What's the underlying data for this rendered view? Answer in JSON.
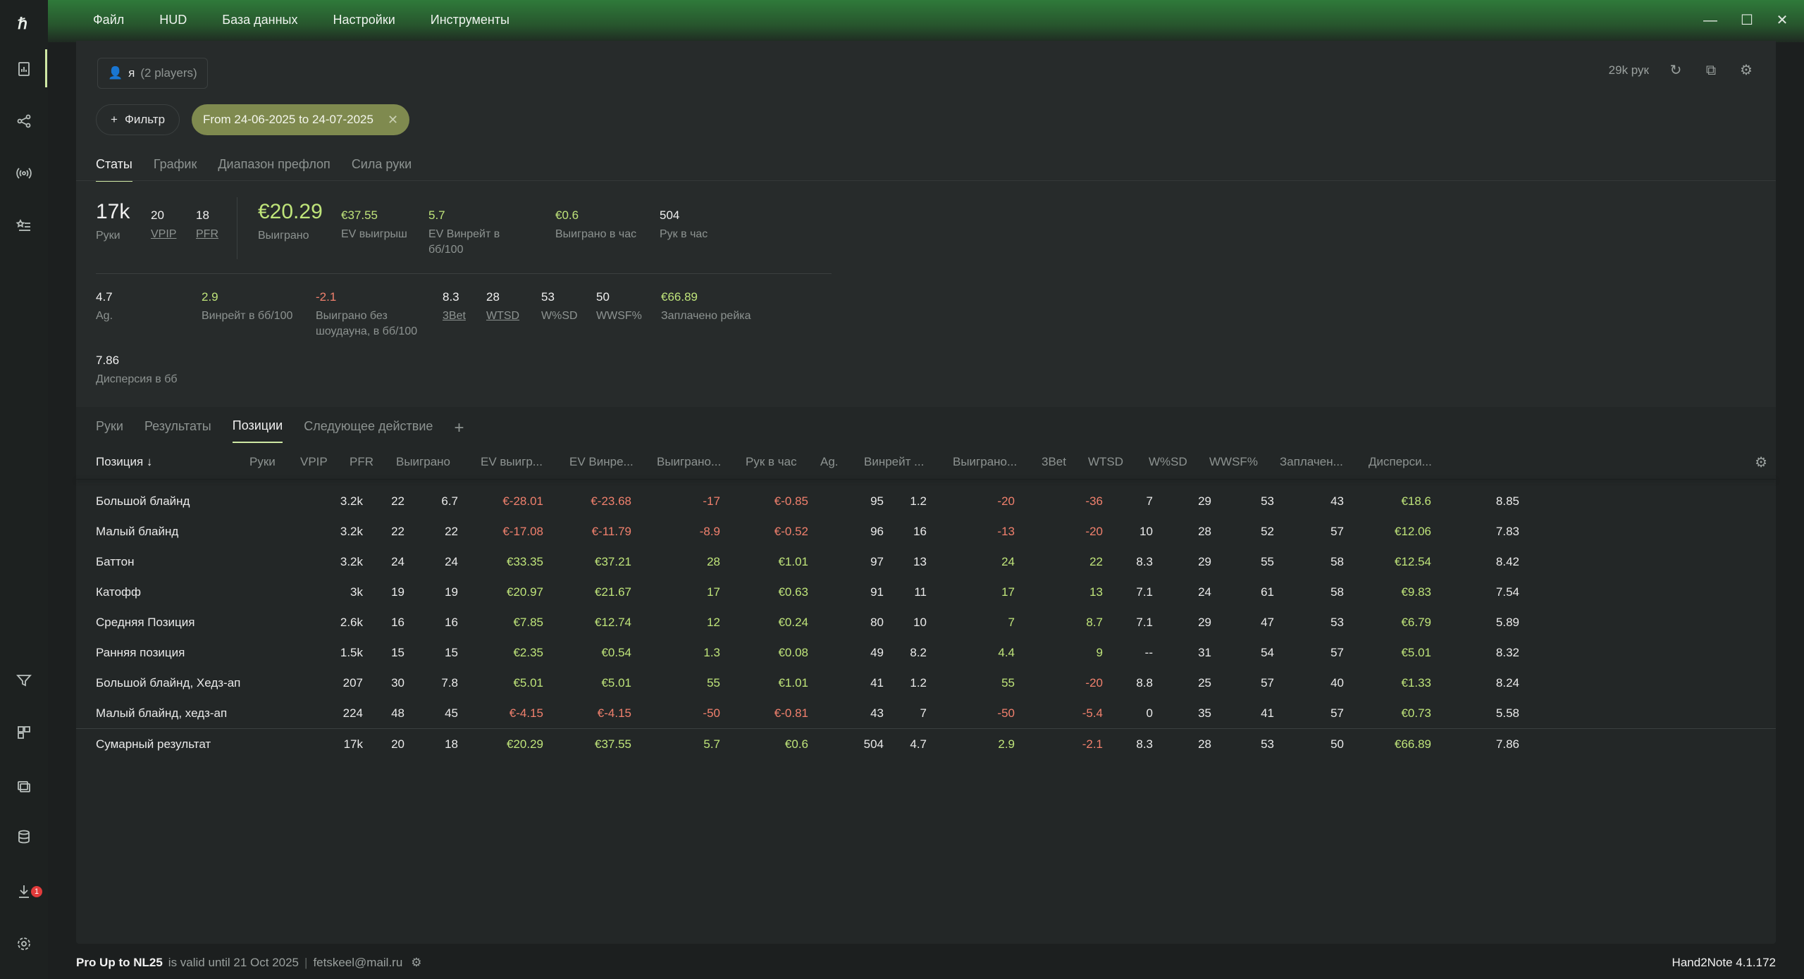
{
  "menu": [
    "Файл",
    "HUD",
    "База данных",
    "Настройки",
    "Инструменты"
  ],
  "window_controls": {
    "minimize": "—",
    "maximize": "☐",
    "close": "✕"
  },
  "sidebar_icons": [
    "reports-icon",
    "share-nodes-icon",
    "broadcast-icon",
    "starred-list-icon",
    "filter-icon",
    "layout-icon",
    "layers-icon",
    "database-icon",
    "download-icon",
    "settings-icon"
  ],
  "sidebar_badge": "1",
  "player": {
    "name": "я",
    "count": "(2 players)"
  },
  "hands_total": "29k рук",
  "filter_label": "Фильтр",
  "date_range": "From 24-06-2025 to 24-07-2025",
  "top_tabs": [
    "Статы",
    "График",
    "Диапазон префлоп",
    "Сила руки"
  ],
  "stats": {
    "hands": {
      "v": "17k",
      "l": "Руки"
    },
    "vpip": {
      "v": "20",
      "l": "VPIP"
    },
    "pfr": {
      "v": "18",
      "l": "PFR"
    },
    "won": {
      "v": "€20.29",
      "l": "Выиграно"
    },
    "ev_won": {
      "v": "€37.55",
      "l": "EV выигрыш"
    },
    "ev_winrate": {
      "v": "5.7",
      "l": "EV Винрейт в бб/100"
    },
    "won_hour": {
      "v": "€0.6",
      "l": "Выиграно в час"
    },
    "hands_hour": {
      "v": "504",
      "l": "Рук в час"
    },
    "ag": {
      "v": "4.7",
      "l": "Ag."
    },
    "winrate": {
      "v": "2.9",
      "l": "Винрейт в бб/100"
    },
    "won_nosd": {
      "v": "-2.1",
      "l": "Выиграно без шоудауна, в бб/100"
    },
    "threebet": {
      "v": "8.3",
      "l": "3Bet"
    },
    "wtsd": {
      "v": "28",
      "l": "WTSD"
    },
    "wsd": {
      "v": "53",
      "l": "W%SD"
    },
    "wwsf": {
      "v": "50",
      "l": "WWSF%"
    },
    "rake": {
      "v": "€66.89",
      "l": "Заплачено рейка"
    },
    "variance": {
      "v": "7.86",
      "l": "Дисперсия в бб"
    }
  },
  "bottom_tabs": [
    "Руки",
    "Результаты",
    "Позиции",
    "Следующее действие"
  ],
  "table": {
    "headers": [
      "Позиция ↓",
      "Руки",
      "VPIP",
      "PFR",
      "Выиграно",
      "EV выигр...",
      "EV Винре...",
      "Выиграно...",
      "Рук в час",
      "Ag.",
      "Винрейт ...",
      "Выиграно...",
      "3Bet",
      "WTSD",
      "W%SD",
      "WWSF%",
      "Заплачен...",
      "Дисперси..."
    ],
    "rows": [
      [
        "Большой блайнд",
        "3.2k",
        "22",
        "6.7",
        "€-28.01",
        "€-23.68",
        "-17",
        "€-0.85",
        "95",
        "1.2",
        "-20",
        "-36",
        "7",
        "29",
        "53",
        "43",
        "€18.6",
        "8.85"
      ],
      [
        "Малый блайнд",
        "3.2k",
        "22",
        "22",
        "€-17.08",
        "€-11.79",
        "-8.9",
        "€-0.52",
        "96",
        "16",
        "-13",
        "-20",
        "10",
        "28",
        "52",
        "57",
        "€12.06",
        "7.83"
      ],
      [
        "Баттон",
        "3.2k",
        "24",
        "24",
        "€33.35",
        "€37.21",
        "28",
        "€1.01",
        "97",
        "13",
        "24",
        "22",
        "8.3",
        "29",
        "55",
        "58",
        "€12.54",
        "8.42"
      ],
      [
        "Катофф",
        "3k",
        "19",
        "19",
        "€20.97",
        "€21.67",
        "17",
        "€0.63",
        "91",
        "11",
        "17",
        "13",
        "7.1",
        "24",
        "61",
        "58",
        "€9.83",
        "7.54"
      ],
      [
        "Средняя Позиция",
        "2.6k",
        "16",
        "16",
        "€7.85",
        "€12.74",
        "12",
        "€0.24",
        "80",
        "10",
        "7",
        "8.7",
        "7.1",
        "29",
        "47",
        "53",
        "€6.79",
        "5.89"
      ],
      [
        "Ранняя позиция",
        "1.5k",
        "15",
        "15",
        "€2.35",
        "€0.54",
        "1.3",
        "€0.08",
        "49",
        "8.2",
        "4.4",
        "9",
        "--",
        "31",
        "54",
        "57",
        "€5.01",
        "8.32"
      ],
      [
        "Большой блайнд, Хедз-ап",
        "207",
        "30",
        "7.8",
        "€5.01",
        "€5.01",
        "55",
        "€1.01",
        "41",
        "1.2",
        "55",
        "-20",
        "8.8",
        "25",
        "57",
        "40",
        "€1.33",
        "8.24"
      ],
      [
        "Малый блайнд, хедз-ап",
        "224",
        "48",
        "45",
        "€-4.15",
        "€-4.15",
        "-50",
        "€-0.81",
        "43",
        "7",
        "-50",
        "-5.4",
        "0",
        "35",
        "41",
        "57",
        "€0.73",
        "5.58"
      ]
    ],
    "total": [
      "Сумарный результат",
      "17k",
      "20",
      "18",
      "€20.29",
      "€37.55",
      "5.7",
      "€0.6",
      "504",
      "4.7",
      "2.9",
      "-2.1",
      "8.3",
      "28",
      "53",
      "50",
      "€66.89",
      "7.86"
    ]
  },
  "footer": {
    "license": "Pro Up to NL25",
    "valid": "is valid until 21 Oct 2025",
    "email": "fetskeel@mail.ru",
    "version": "Hand2Note 4.1.172"
  },
  "colors": {
    "accent": "#cfe8a4",
    "positive": "#bfe47a",
    "negative": "#f0806d",
    "chip": "#7f8a4f"
  }
}
